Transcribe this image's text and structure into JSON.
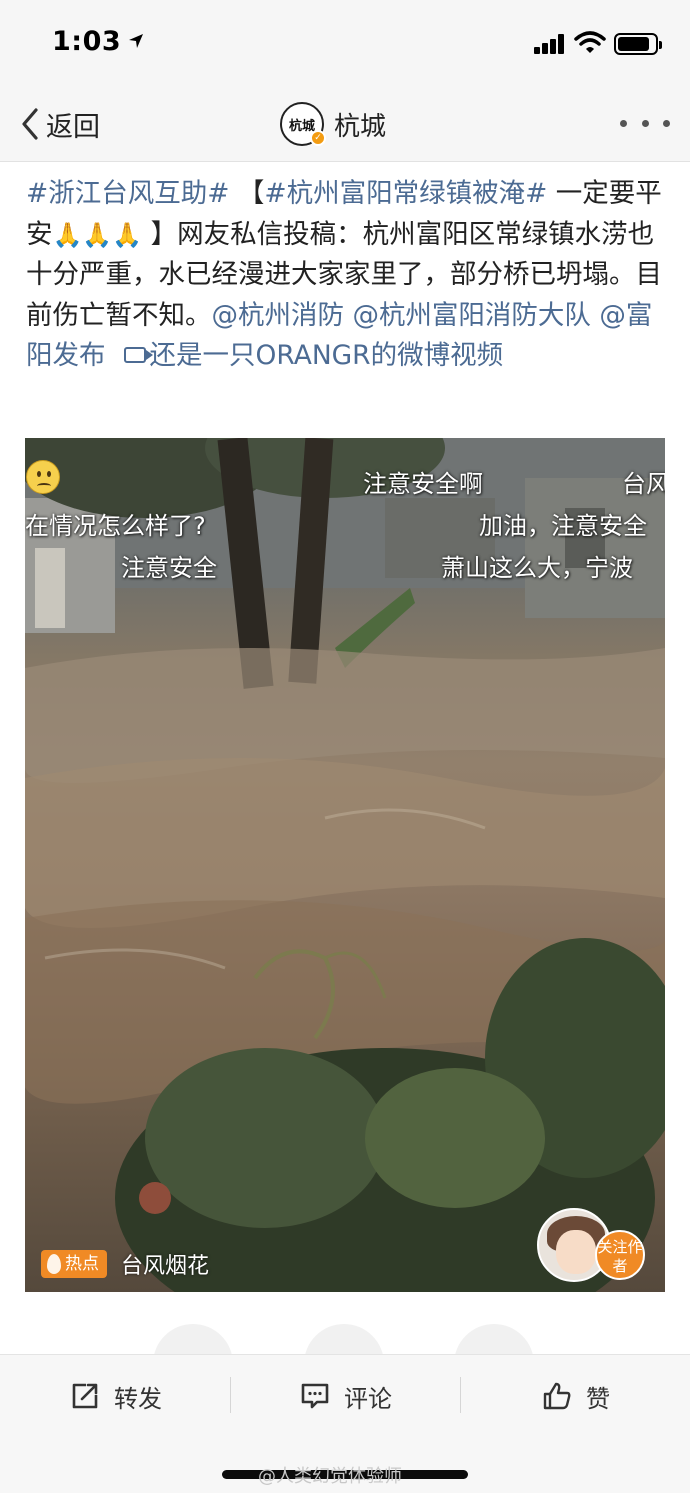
{
  "status_bar": {
    "time": "1:03"
  },
  "nav": {
    "back_label": "返回",
    "logo_text": "杭城",
    "title": "杭城"
  },
  "post": {
    "hashtag_1": "#浙江台风互助#",
    "bracket_open": " 【",
    "hashtag_2": "#杭州富阳常绿镇被淹#",
    "text_1": " 一定要平安",
    "emoji": "🙏🙏🙏",
    "text_2": " 】网友私信投稿：杭州富阳区常绿镇水涝也十分严重，水已经漫进大家家里了，部分桥已坍塌。目前伤亡暂不知。",
    "mention_1": "@杭州消防",
    "mention_2": "@杭州富阳消防大队",
    "mention_3": "@富阳发布",
    "video_link": "还是一只ORANGR的微博视频"
  },
  "video": {
    "danmaku": [
      "注意安全啊",
      "台风",
      "在情况怎么样了?",
      "加油，注意安全",
      "注意安全",
      "萧山这么大，宁波"
    ],
    "hot_badge": "热点",
    "topic": "台风烟花",
    "follow_label": "关注作者"
  },
  "actions": {
    "repost": "转发",
    "comment": "评论",
    "like": "赞"
  },
  "watermark": "@人类幻觉体验师",
  "colors": {
    "link": "#4c6b93",
    "accent": "#f08a25",
    "bar_bg": "#f6f6f6"
  }
}
